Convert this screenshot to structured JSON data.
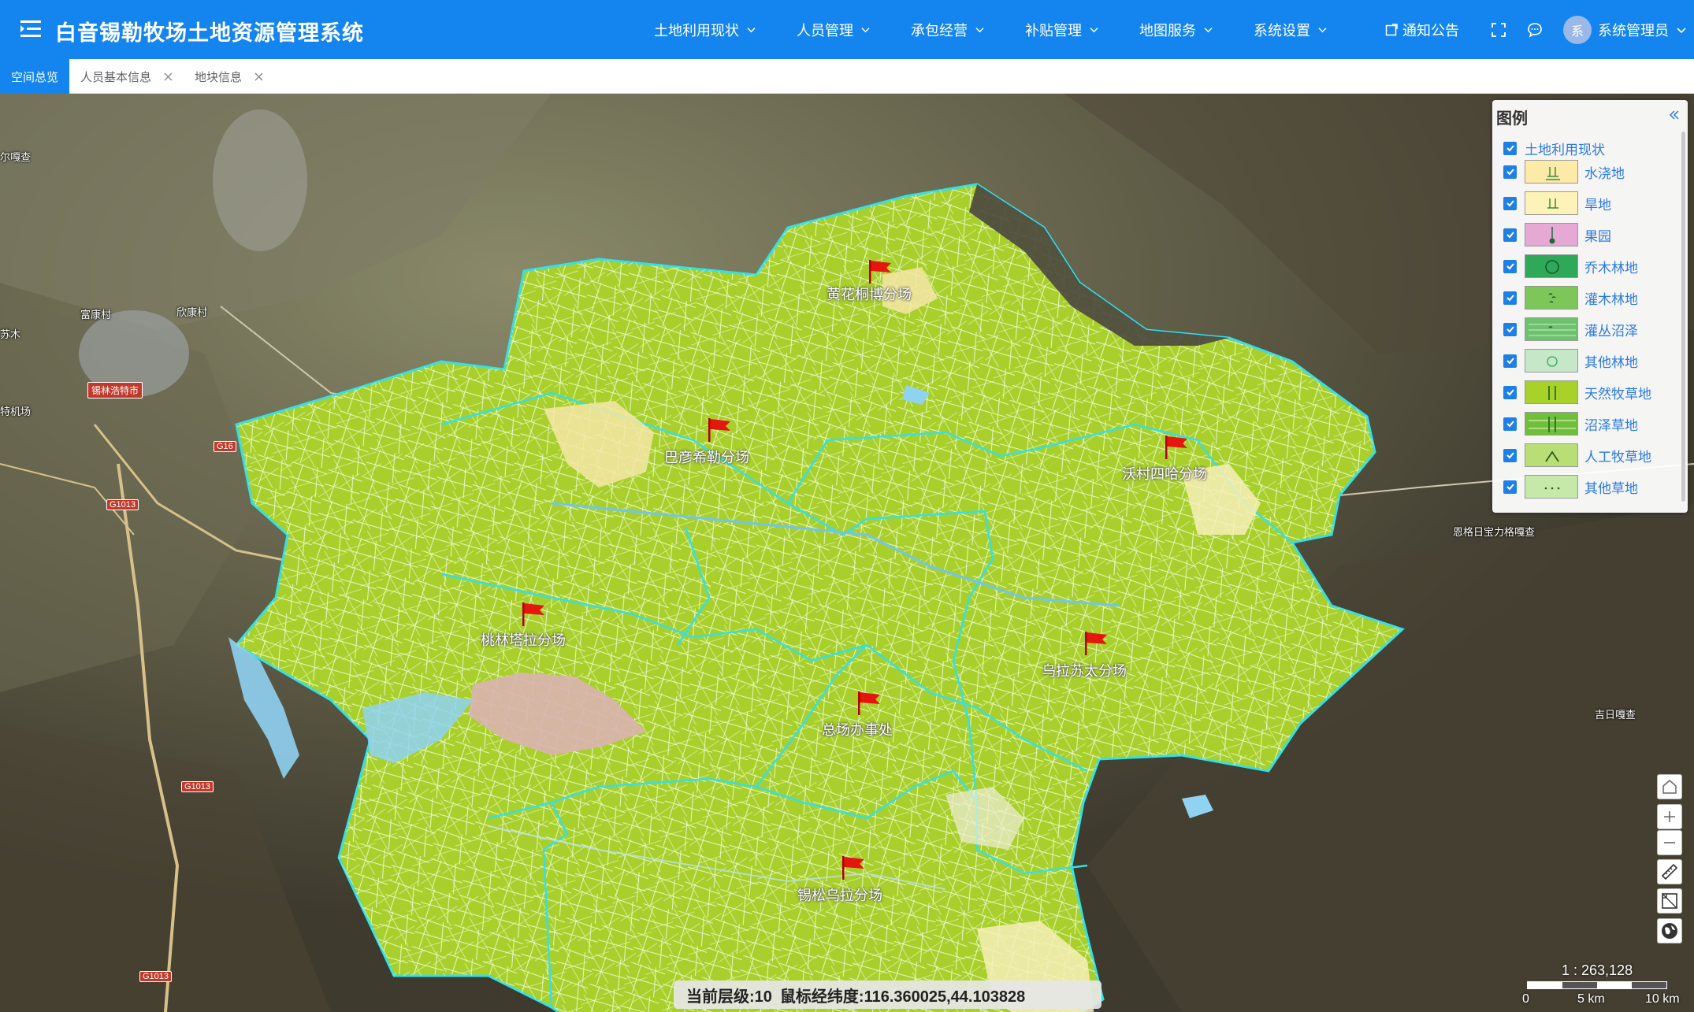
{
  "app": {
    "title": "白音锡勒牧场土地资源管理系统"
  },
  "nav": [
    {
      "label": "土地利用现状"
    },
    {
      "label": "人员管理"
    },
    {
      "label": "承包经营"
    },
    {
      "label": "补贴管理"
    },
    {
      "label": "地图服务"
    },
    {
      "label": "系统设置"
    }
  ],
  "header_tools": {
    "notice_label": "通知公告",
    "user_name": "系统管理员",
    "avatar_text": "系"
  },
  "tabs": [
    {
      "label": "空间总览",
      "active": true,
      "closable": false
    },
    {
      "label": "人员基本信息",
      "active": false,
      "closable": true
    },
    {
      "label": "地块信息",
      "active": false,
      "closable": true
    }
  ],
  "map": {
    "place_labels": [
      {
        "text": "尔嘎查"
      },
      {
        "text": "富康村"
      },
      {
        "text": "欣康村"
      },
      {
        "text": "苏木"
      },
      {
        "text": "特机场"
      },
      {
        "text": "恩格日宝力格嘎查"
      },
      {
        "text": "吉日嘎查"
      }
    ],
    "city_label": "锡林浩特市",
    "road_labels": [
      "G16",
      "G1013",
      "G1013",
      "G1013"
    ],
    "farm_labels": [
      {
        "text": "黄花桐博分场"
      },
      {
        "text": "巴彦希勒分场"
      },
      {
        "text": "沃村四哈分场"
      },
      {
        "text": "桃林塔拉分场"
      },
      {
        "text": "乌拉苏太分场"
      },
      {
        "text": "总场办事处"
      },
      {
        "text": "锡松乌拉分场"
      }
    ]
  },
  "legend": {
    "title": "图例",
    "group_label": "土地利用现状",
    "items": [
      {
        "label": "水浇地",
        "color": "#fde9a8",
        "icon": "irrigated-icon"
      },
      {
        "label": "旱地",
        "color": "#fdf3b8",
        "icon": "dryland-icon"
      },
      {
        "label": "果园",
        "color": "#e6a8d5",
        "icon": "orchard-icon"
      },
      {
        "label": "乔木林地",
        "color": "#2fa85a",
        "icon": "forest-icon"
      },
      {
        "label": "灌木林地",
        "color": "#7dc65a",
        "icon": "shrub-icon"
      },
      {
        "label": "灌丛沼泽",
        "color": "#6ec26e",
        "icon": "shrub-marsh-icon"
      },
      {
        "label": "其他林地",
        "color": "#c6e8c8",
        "icon": "other-forest-icon"
      },
      {
        "label": "天然牧草地",
        "color": "#a8d12a",
        "icon": "natural-grass-icon"
      },
      {
        "label": "沼泽草地",
        "color": "#6fbf3a",
        "icon": "marsh-grass-icon"
      },
      {
        "label": "人工牧草地",
        "color": "#b9de76",
        "icon": "artificial-grass-icon"
      },
      {
        "label": "其他草地",
        "color": "#c6e8a8",
        "icon": "other-grass-icon"
      }
    ]
  },
  "status": {
    "level_label": "当前层级:10",
    "coord_label": "鼠标经纬度:116.360025,44.103828"
  },
  "scale": {
    "ratio": "1 : 263,128",
    "ticks": [
      "0",
      "5 km",
      "10 km"
    ]
  }
}
